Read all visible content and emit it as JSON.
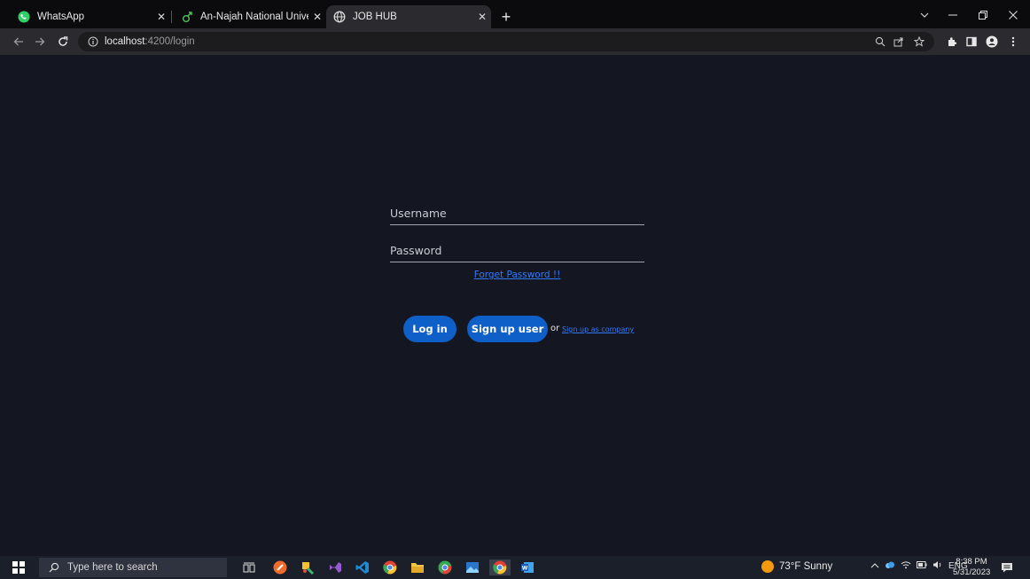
{
  "browser": {
    "tabs": [
      {
        "title": "WhatsApp",
        "favicon": "whatsapp-icon"
      },
      {
        "title": "An-Najah National University ten",
        "favicon": "najah-icon"
      },
      {
        "title": "JOB HUB",
        "favicon": "globe-icon",
        "active": true
      }
    ],
    "url_host": "localhost",
    "url_path": ":4200/login"
  },
  "login": {
    "username_placeholder": "Username",
    "password_placeholder": "Password",
    "forgot_link": "Forget Password !!",
    "login_button": "Log in",
    "signup_user_button": "Sign up user",
    "or_text": "or",
    "signup_company_link": "Sign up as company"
  },
  "taskbar": {
    "search_placeholder": "Type here to search",
    "weather": "73°F  Sunny",
    "language": "ENG",
    "time": "8:38 PM",
    "date": "5/31/2023"
  },
  "colors": {
    "page_bg": "#141622",
    "accent_button": "#0f5fc8",
    "link": "#2f7bff"
  }
}
